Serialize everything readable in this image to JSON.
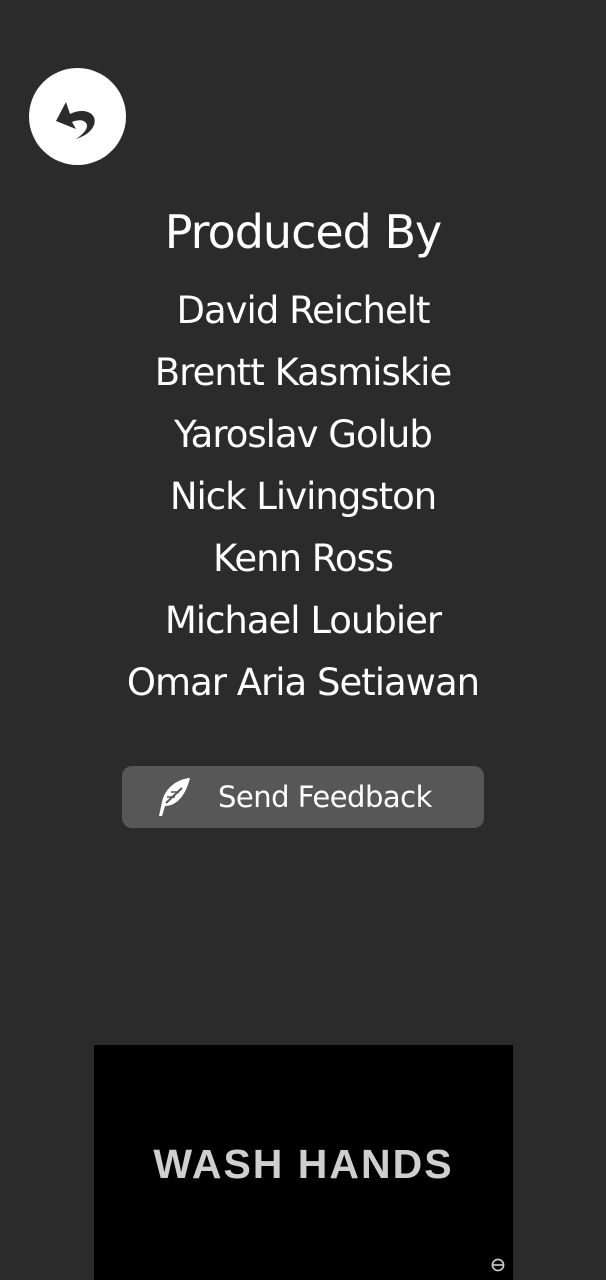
{
  "credits": {
    "title": "Produced By",
    "names": [
      "David Reichelt",
      "Brentt Kasmiskie",
      "Yaroslav Golub",
      "Nick Livingston",
      "Kenn Ross",
      "Michael Loubier",
      "Omar Aria Setiawan"
    ]
  },
  "feedback": {
    "label": "Send Feedback",
    "icon": "feather-icon"
  },
  "back": {
    "icon": "undo-arrow-icon"
  },
  "ad": {
    "text": "WASH HANDS",
    "icon": "ad-choices-icon"
  },
  "colors": {
    "background": "#2b2b2b",
    "button": "#575757",
    "ad_background": "#000000",
    "text": "#ffffff"
  }
}
